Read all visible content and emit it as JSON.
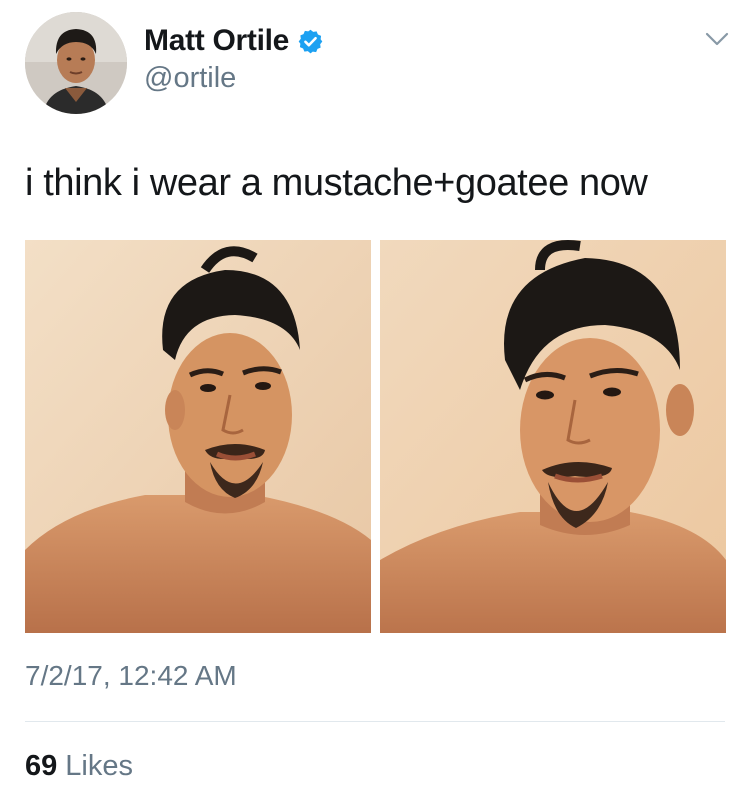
{
  "tweet": {
    "author": {
      "display_name": "Matt Ortile",
      "handle": "@ortile",
      "verified": true,
      "avatar_icon": "profile-photo"
    },
    "menu_icon": "chevron-down-icon",
    "text": "i think i wear a mustache+goatee now",
    "media": [
      {
        "kind": "photo",
        "description_icon": "selfie-photo"
      },
      {
        "kind": "photo",
        "description_icon": "selfie-photo"
      }
    ],
    "timestamp": "7/2/17, 12:42 AM",
    "stats": {
      "likes_count": "69",
      "likes_label": "Likes"
    },
    "colors": {
      "verified_badge": "#1da1f2",
      "secondary_text": "#657786",
      "primary_text": "#14171a",
      "divider": "#e1e8ed"
    }
  }
}
